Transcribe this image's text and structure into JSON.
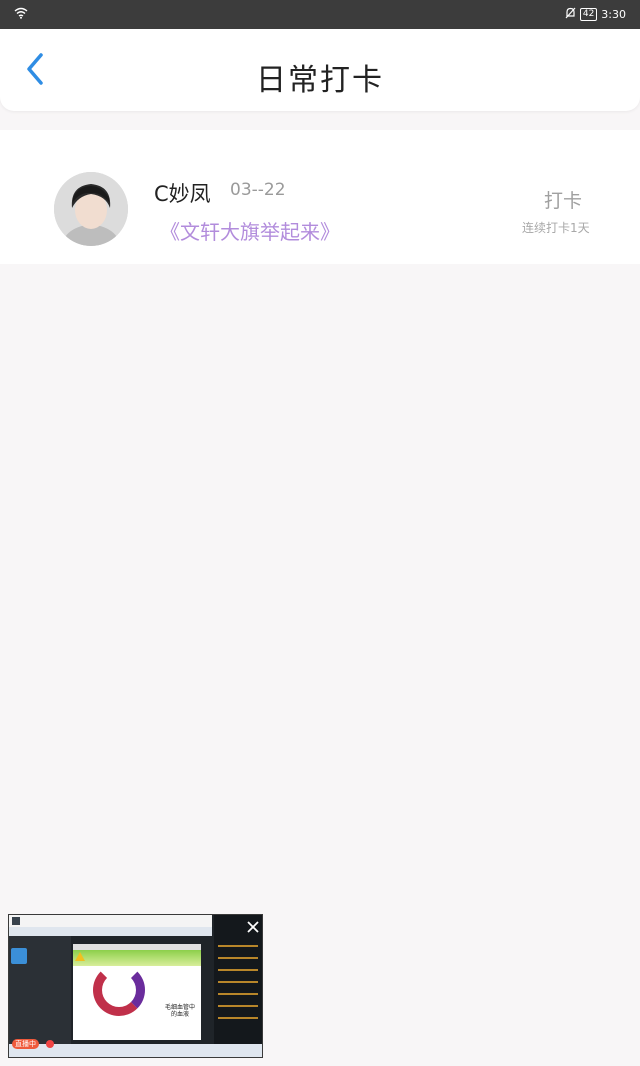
{
  "status_bar": {
    "battery": "42",
    "time": "3:30",
    "icons": [
      "wifi-icon",
      "bell-off-icon",
      "battery-icon"
    ]
  },
  "header": {
    "title": "日常打卡",
    "back_icon": "chevron-left-icon"
  },
  "checkin_list": [
    {
      "user_name": "C妙凤",
      "date": "03--22",
      "post_title": "《文轩大旗举起来》",
      "action_label": "打卡",
      "streak_label": "连续打卡1天"
    }
  ],
  "floating_window": {
    "live_badge": "直播中",
    "slide_caption": "毛细血管中的血液",
    "close_icon": "close-icon"
  },
  "colors": {
    "accent_blue": "#2f8de4",
    "title_purple": "#b28cdc",
    "status_bar_bg": "#3c3c3c",
    "page_bg": "#f8f6f7"
  }
}
